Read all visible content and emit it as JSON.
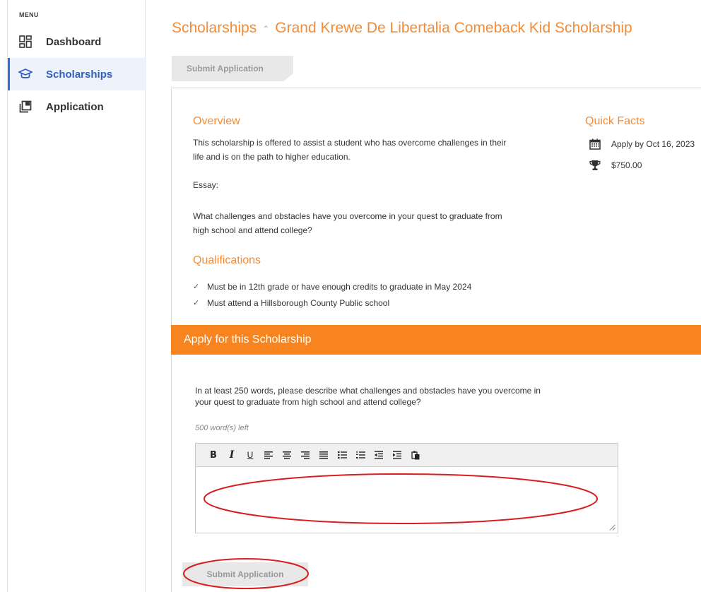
{
  "sidebar": {
    "menu_label": "MENU",
    "items": [
      {
        "label": "Dashboard",
        "icon": "dashboard-grid-icon",
        "active": false
      },
      {
        "label": "Scholarships",
        "icon": "graduation-cap-icon",
        "active": true
      },
      {
        "label": "Application",
        "icon": "application-stack-icon",
        "active": false
      }
    ]
  },
  "header": {
    "breadcrumb_parent": "Scholarships",
    "separator": "⌃",
    "title": "Grand Krewe De Libertalia Comeback Kid Scholarship"
  },
  "tabs": {
    "submit_label": "Submit Application"
  },
  "overview": {
    "title": "Overview",
    "text_line1": "This scholarship is offered to assist a student who has overcome challenges in their",
    "text_line2": "life and is on the path to higher education.",
    "essay_label": "Essay:",
    "essay_line1": "What challenges and obstacles have you overcome in your quest to graduate from",
    "essay_line2": "high school and attend college?"
  },
  "quick_facts": {
    "title": "Quick Facts",
    "deadline": "Apply by Oct 16, 2023",
    "amount": "$750.00"
  },
  "qualifications": {
    "title": "Qualifications",
    "items": [
      "Must be in 12th grade or have enough credits to graduate in May 2024",
      "Must attend a Hillsborough County Public school"
    ]
  },
  "apply": {
    "title": "Apply for this Scholarship",
    "question_line1": "In at least 250 words, please describe what challenges and obstacles have you overcome in",
    "question_line2": "your quest to graduate from high school and attend college?",
    "words_left": "500 word(s) left",
    "submit_label": "Submit Application"
  },
  "colors": {
    "accent": "#f28c38",
    "apply_bar": "#f7841f",
    "active_nav": "#2f5fbf",
    "annotation": "#d81e1e"
  }
}
